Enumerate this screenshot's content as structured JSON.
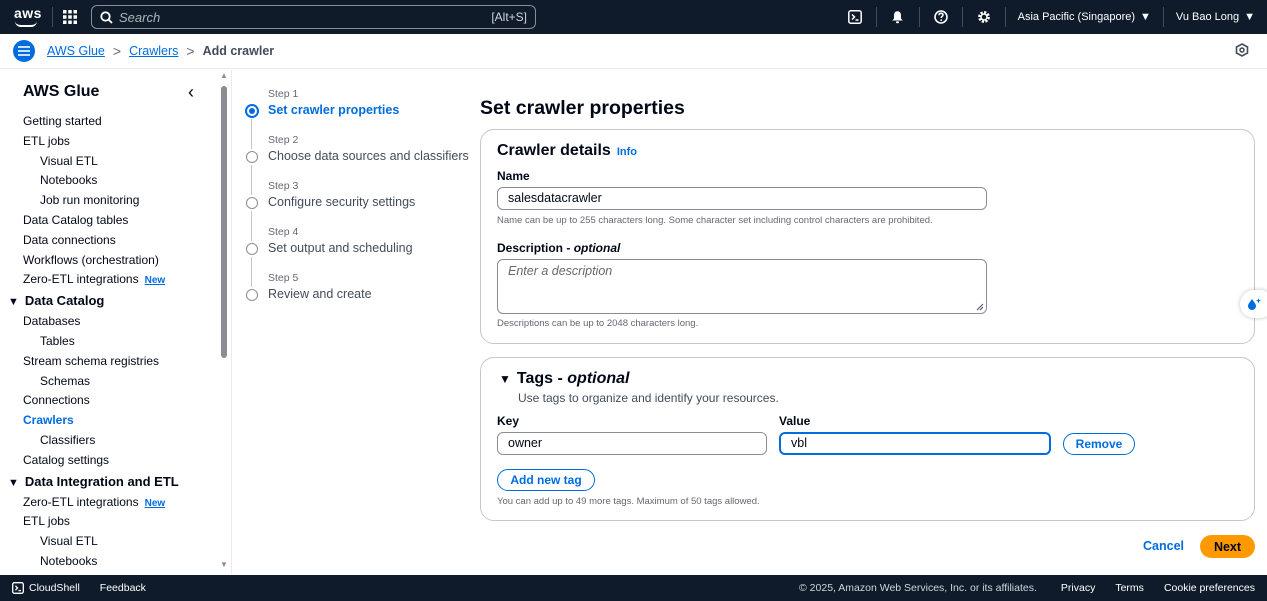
{
  "topnav": {
    "logo_text": "aws",
    "search_placeholder": "Search",
    "search_shortcut": "[Alt+S]",
    "region": "Asia Pacific (Singapore)",
    "user": "Vu Bao Long",
    "icons": [
      "cloudshell-icon",
      "bell-icon",
      "help-icon",
      "gear-icon"
    ]
  },
  "breadcrumb": {
    "items": [
      "AWS Glue",
      "Crawlers"
    ],
    "current": "Add crawler"
  },
  "sidebar": {
    "title": "AWS Glue",
    "items": [
      {
        "label": "Getting started",
        "level": 1
      },
      {
        "label": "ETL jobs",
        "level": 1
      },
      {
        "label": "Visual ETL",
        "level": 2
      },
      {
        "label": "Notebooks",
        "level": 2
      },
      {
        "label": "Job run monitoring",
        "level": 2
      },
      {
        "label": "Data Catalog tables",
        "level": 1
      },
      {
        "label": "Data connections",
        "level": 1
      },
      {
        "label": "Workflows (orchestration)",
        "level": 1
      },
      {
        "label": "Zero-ETL integrations",
        "level": 1,
        "badge": "New"
      },
      {
        "label": "Data Catalog",
        "level": 0,
        "section": true
      },
      {
        "label": "Databases",
        "level": 1
      },
      {
        "label": "Tables",
        "level": 2
      },
      {
        "label": "Stream schema registries",
        "level": 1
      },
      {
        "label": "Schemas",
        "level": 2
      },
      {
        "label": "Connections",
        "level": 1
      },
      {
        "label": "Crawlers",
        "level": 1,
        "active": true
      },
      {
        "label": "Classifiers",
        "level": 2
      },
      {
        "label": "Catalog settings",
        "level": 1
      },
      {
        "label": "Data Integration and ETL",
        "level": 0,
        "section": true
      },
      {
        "label": "Zero-ETL integrations",
        "level": 1,
        "badge": "New"
      },
      {
        "label": "ETL jobs",
        "level": 1
      },
      {
        "label": "Visual ETL",
        "level": 2
      },
      {
        "label": "Notebooks",
        "level": 2
      }
    ]
  },
  "steps": [
    {
      "label": "Step 1",
      "name": "Set crawler properties",
      "current": true
    },
    {
      "label": "Step 2",
      "name": "Choose data sources and classifiers"
    },
    {
      "label": "Step 3",
      "name": "Configure security settings"
    },
    {
      "label": "Step 4",
      "name": "Set output and scheduling"
    },
    {
      "label": "Step 5",
      "name": "Review and create"
    }
  ],
  "main": {
    "title": "Set crawler properties",
    "details": {
      "heading": "Crawler details",
      "info": "Info",
      "name_label": "Name",
      "name_value": "salesdatacrawler",
      "name_hint": "Name can be up to 255 characters long. Some character set including control characters are prohibited.",
      "desc_label": "Description - ",
      "desc_optional": "optional",
      "desc_placeholder": "Enter a description",
      "desc_hint": "Descriptions can be up to 2048 characters long."
    },
    "tags": {
      "heading": "Tags - ",
      "heading_optional": "optional",
      "description": "Use tags to organize and identify your resources.",
      "key_label": "Key",
      "value_label": "Value",
      "key_value": "owner",
      "value_value": "vbl",
      "remove_label": "Remove",
      "add_label": "Add new tag",
      "hint": "You can add up to 49 more tags. Maximum of 50 tags allowed."
    },
    "cancel_label": "Cancel",
    "next_label": "Next"
  },
  "footer": {
    "cloudshell": "CloudShell",
    "feedback": "Feedback",
    "copyright": "© 2025, Amazon Web Services, Inc. or its affiliates.",
    "privacy": "Privacy",
    "terms": "Terms",
    "cookies": "Cookie preferences"
  }
}
